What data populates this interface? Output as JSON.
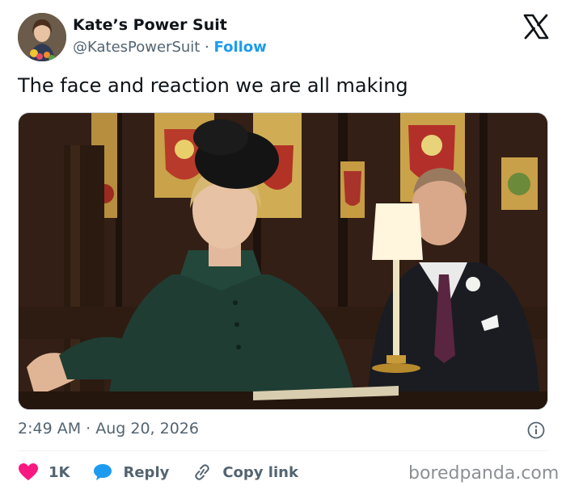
{
  "author": {
    "name": "Kate’s Power Suit",
    "handle": "@KatesPowerSuit",
    "separator": " · ",
    "follow_label": "Follow"
  },
  "tweet": {
    "text": "The face and reaction we are all making"
  },
  "meta": {
    "timestamp": "2:49 AM · Aug 20, 2026"
  },
  "actions": {
    "like_count": "1K",
    "reply_label": "Reply",
    "copy_link_label": "Copy link"
  },
  "watermark": "boredpanda.com",
  "icons": {
    "logo": "x-logo-icon",
    "like": "heart-icon",
    "reply": "reply-bubble-icon",
    "copy": "link-icon",
    "info": "info-icon"
  },
  "colors": {
    "accent": "#1d9bf0",
    "like": "#f91880",
    "secondary_text": "#536471"
  }
}
